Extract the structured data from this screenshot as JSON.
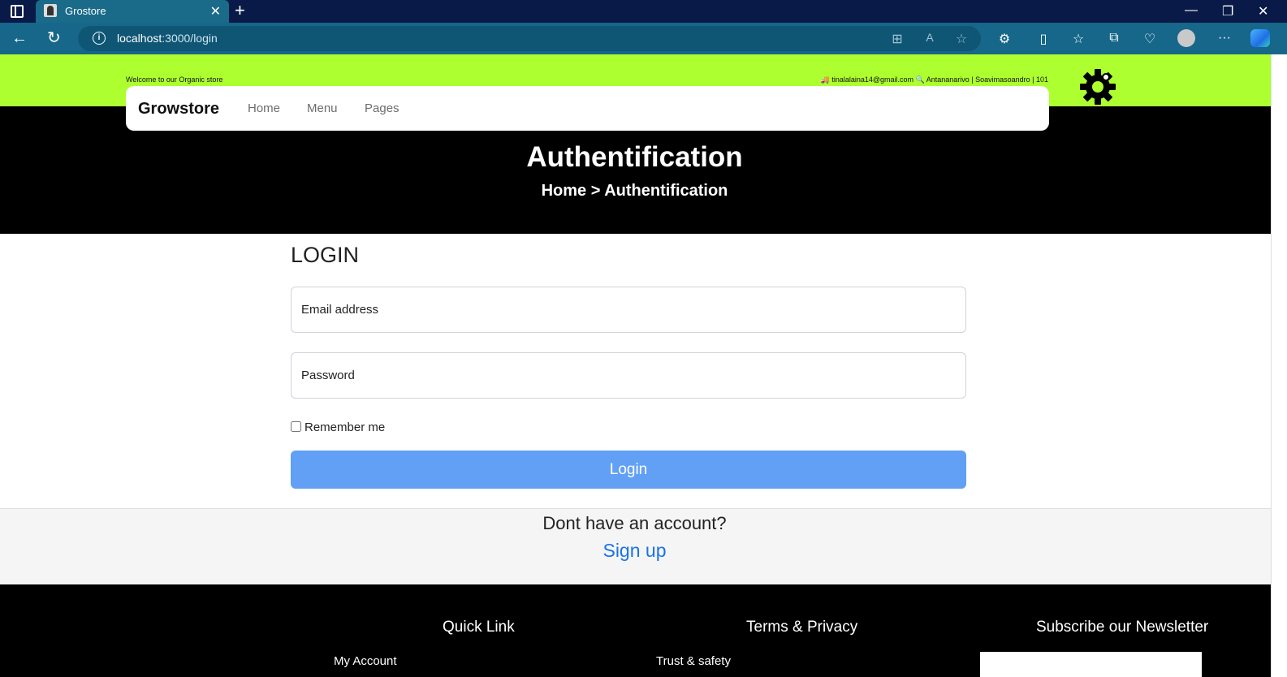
{
  "browser": {
    "tab_title": "Grostore",
    "url_host": "localhost",
    "url_rest": ":3000/login"
  },
  "topbar": {
    "welcome": "Welcome to our Organic store",
    "contact": "🚚 tinalalaina14@gmail.com 🔍 Antananarivo | Soavimasoandro | 101"
  },
  "navbar": {
    "brand": "Growstore",
    "links": [
      "Home",
      "Menu",
      "Pages"
    ]
  },
  "hero": {
    "title": "Authentification",
    "breadcrumb": "Home > Authentification"
  },
  "login": {
    "heading": "LOGIN",
    "email_placeholder": "Email address",
    "password_placeholder": "Password",
    "remember_label": "Remember me",
    "button_label": "Login"
  },
  "signup": {
    "question": "Dont have an account?",
    "link_label": "Sign up"
  },
  "footer": {
    "quick_link_heading": "Quick Link",
    "terms_heading": "Terms & Privacy",
    "newsletter_heading": "Subscribe our Newsletter",
    "my_account": "My Account",
    "trust_safety": "Trust & safety"
  },
  "colors": {
    "topbar": "#adff2f",
    "hero": "#000000",
    "login_button": "#61a0f5",
    "signup_link": "#1a73e8"
  }
}
